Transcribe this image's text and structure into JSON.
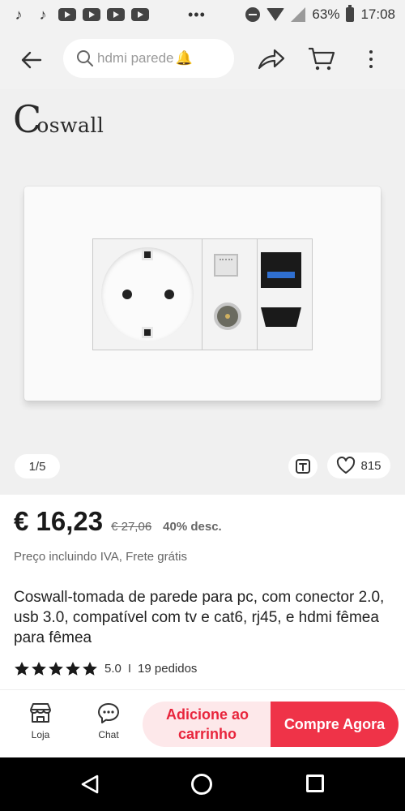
{
  "status_bar": {
    "overflow": "•••",
    "battery": "63%",
    "time": "17:08",
    "app_icons": [
      "tiktok-icon",
      "tiktok-icon",
      "youtube-icon",
      "youtube-icon",
      "youtube-icon",
      "youtube-icon"
    ]
  },
  "header": {
    "search_text": "hdmi parede",
    "search_emoji": "🔔",
    "icons": [
      "back-arrow-icon",
      "search-icon",
      "bell-icon",
      "share-icon",
      "cart-icon",
      "more-vert-icon"
    ]
  },
  "gallery": {
    "brand_c": "C",
    "brand_rest": "oswall",
    "pager": "1/5",
    "wishlist_count": "815"
  },
  "product": {
    "price": "€ 16,23",
    "old_price": "€ 27,06",
    "discount": "40% desc.",
    "tax_note": "Preço incluindo IVA, Frete grátis",
    "title": "Coswall-tomada de parede para pc, com conector 2.0, usb 3.0, compatível com tv e cat6, rj45, e hdmi fêmea para fêmea",
    "rating": "5.0",
    "rating_stars": 5,
    "separator": "I",
    "orders": "19 pedidos"
  },
  "actions": {
    "store_label": "Loja",
    "chat_label": "Chat",
    "add_to_cart": "Adicione ao carrinho",
    "buy_now": "Compre Agora"
  },
  "colors": {
    "accent": "#ef3348",
    "accent_light": "#fde8ea",
    "header_bg": "#f2f2f2"
  }
}
